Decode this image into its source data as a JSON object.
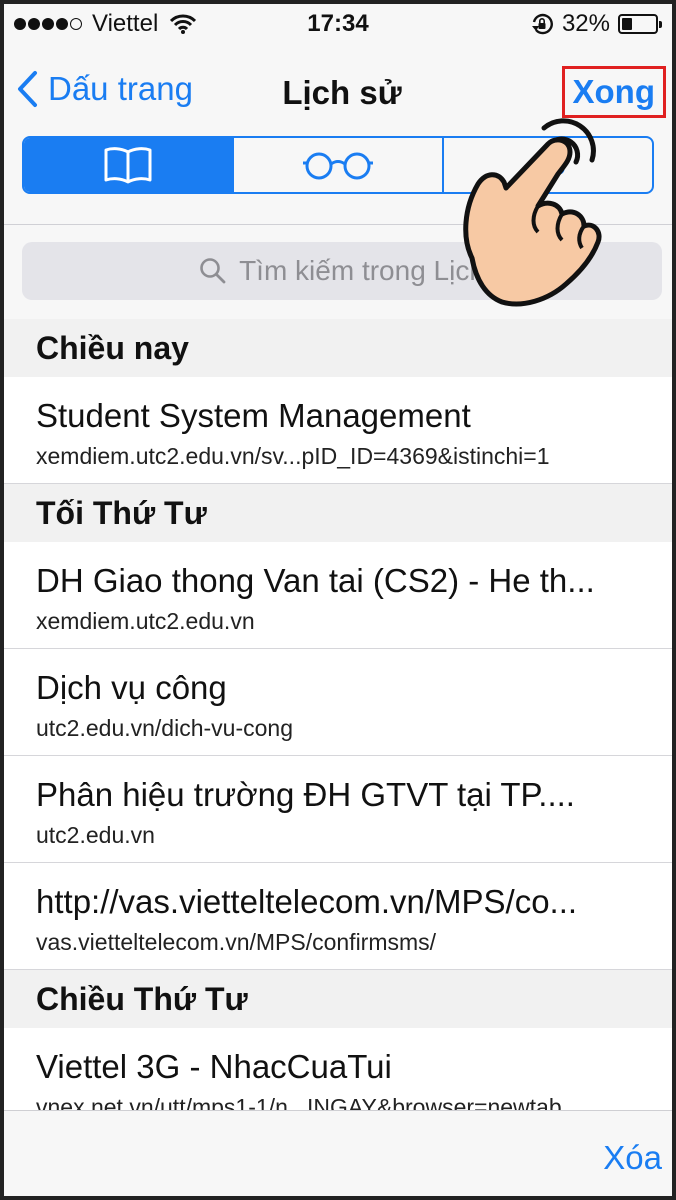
{
  "status_bar": {
    "carrier": "Viettel",
    "time": "17:34",
    "battery_percent": "32%",
    "battery_level": 0.32,
    "signal_dots_filled": 4,
    "signal_dots_total": 5
  },
  "nav": {
    "back_label": "Dấu trang",
    "title": "Lịch sử",
    "done_label": "Xong"
  },
  "segments": [
    {
      "icon": "book-icon",
      "active": true
    },
    {
      "icon": "glasses-icon",
      "active": false
    },
    {
      "icon": "at-icon",
      "active": false
    }
  ],
  "search": {
    "placeholder": "Tìm kiếm trong Lịch"
  },
  "sections": [
    {
      "header": "Chiều nay",
      "items": [
        {
          "title": "Student System Management",
          "url": "xemdiem.utc2.edu.vn/sv...pID_ID=4369&istinchi=1"
        }
      ]
    },
    {
      "header": "Tối Thứ Tư",
      "items": [
        {
          "title": "DH Giao thong Van tai (CS2) - He th...",
          "url": "xemdiem.utc2.edu.vn"
        },
        {
          "title": "Dịch vụ công",
          "url": "utc2.edu.vn/dich-vu-cong"
        },
        {
          "title": "Phân hiệu trường ĐH GTVT tại TP....",
          "url": "utc2.edu.vn"
        },
        {
          "title": "http://vas.vietteltelecom.vn/MPS/co...",
          "url": "vas.vietteltelecom.vn/MPS/confirmsms/"
        }
      ]
    },
    {
      "header": "Chiều Thứ Tư",
      "items": [
        {
          "title": "Viettel 3G - NhacCuaTui",
          "url": "vnex.net.vn/utt/mps1-1/n...INGAY&browser=newtab"
        }
      ]
    }
  ],
  "toolbar": {
    "clear_label": "Xóa"
  },
  "colors": {
    "accent": "#1a7df2",
    "highlight_border": "#e02020",
    "hand_skin": "#f7c9a4"
  }
}
